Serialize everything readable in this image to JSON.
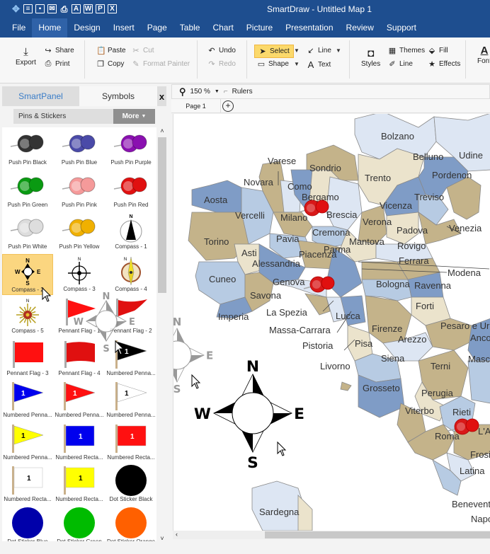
{
  "titlebar": {
    "title": "SmartDraw - Untitled Map 1",
    "quick_access": [
      "app-logo",
      "new-document",
      "save",
      "email",
      "print",
      "export-pdf",
      "export-word",
      "export-powerpoint",
      "export-excel"
    ]
  },
  "menu": {
    "items": [
      "File",
      "Home",
      "Design",
      "Insert",
      "Page",
      "Table",
      "Chart",
      "Picture",
      "Presentation",
      "Review",
      "Support"
    ],
    "active": "Home"
  },
  "ribbon": {
    "export": "Export",
    "share": "Share",
    "print": "Print",
    "paste": "Paste",
    "cut": "Cut",
    "copy": "Copy",
    "format_painter": "Format Painter",
    "undo": "Undo",
    "redo": "Redo",
    "select": "Select",
    "line": "Line",
    "shape": "Shape",
    "text": "Text",
    "styles": "Styles",
    "themes": "Themes",
    "line2": "Line",
    "fill": "Fill",
    "effects": "Effects",
    "font": "Font"
  },
  "leftpanel": {
    "tab_smartpanel": "SmartPanel",
    "tab_symbols": "Symbols",
    "close": "x",
    "library": "Pins & Stickers",
    "more": "More",
    "symbols": [
      {
        "label": "Push Pin Black",
        "kind": "pin",
        "color": "#333333"
      },
      {
        "label": "Push Pin Blue",
        "kind": "pin",
        "color": "#4a4aa8"
      },
      {
        "label": "Push Pin Purple",
        "kind": "pin",
        "color": "#8a10b0"
      },
      {
        "label": "Push Pin Green",
        "kind": "pin",
        "color": "#0a9a12"
      },
      {
        "label": "Push Pin Pink",
        "kind": "pin",
        "color": "#f59a9a"
      },
      {
        "label": "Push Pin Red",
        "kind": "pin",
        "color": "#e01010"
      },
      {
        "label": "Push Pin White",
        "kind": "pin",
        "color": "#dddddd"
      },
      {
        "label": "Push Pin Yellow",
        "kind": "pin",
        "color": "#f0b000"
      },
      {
        "label": "Compass - 1",
        "kind": "compass1"
      },
      {
        "label": "Compass - 2",
        "kind": "compass2",
        "selected": true
      },
      {
        "label": "Compass - 3",
        "kind": "compass3"
      },
      {
        "label": "Compass - 4",
        "kind": "compass4"
      },
      {
        "label": "Compass - 5",
        "kind": "compass5"
      },
      {
        "label": "Pennant Flag - 1",
        "kind": "pennant",
        "color": "#ff1010"
      },
      {
        "label": "Pennant Flag - 2",
        "kind": "wavy",
        "color": "#e01010"
      },
      {
        "label": "Pennant Flag - 3",
        "kind": "rectflag",
        "color": "#ff1010"
      },
      {
        "label": "Pennant Flag - 4",
        "kind": "wavyrect",
        "color": "#e01010"
      },
      {
        "label": "Numbered Penna...",
        "kind": "numpennant",
        "color": "#000000",
        "text_color": "#ffffff",
        "number": "1"
      },
      {
        "label": "Numbered Penna...",
        "kind": "numpennant",
        "color": "#0000ee",
        "text_color": "#ffffff",
        "number": "1"
      },
      {
        "label": "Numbered Penna...",
        "kind": "numpennant",
        "color": "#ff1010",
        "text_color": "#ffffff",
        "number": "1"
      },
      {
        "label": "Numbered Penna...",
        "kind": "numpennant",
        "color": "#ffffff",
        "text_color": "#000000",
        "number": "1"
      },
      {
        "label": "Numbered Penna...",
        "kind": "numpennant",
        "color": "#ffff00",
        "text_color": "#000000",
        "number": "1"
      },
      {
        "label": "Numbered Recta...",
        "kind": "numrect",
        "color": "#0000ee",
        "text_color": "#ffffff",
        "number": "1"
      },
      {
        "label": "Numbered Recta...",
        "kind": "numrect",
        "color": "#ff1010",
        "text_color": "#ffffff",
        "number": "1"
      },
      {
        "label": "Numbered Recta...",
        "kind": "numrect",
        "color": "#ffffff",
        "text_color": "#000000",
        "number": "1"
      },
      {
        "label": "Numbered Recta...",
        "kind": "numrect",
        "color": "#ffff00",
        "text_color": "#000000",
        "number": "1"
      },
      {
        "label": "Dot Sticker Black",
        "kind": "dot",
        "color": "#000000"
      },
      {
        "label": "Dot Sticker Blue",
        "kind": "dot",
        "color": "#0000aa"
      },
      {
        "label": "Dot Sticker Green",
        "kind": "dot",
        "color": "#00bb00"
      },
      {
        "label": "Dot Sticker Orange",
        "kind": "dot",
        "color": "#ff6000"
      }
    ]
  },
  "canvas": {
    "zoom": "150 %",
    "rulers": "Rulers",
    "page_tab": "Page 1",
    "compass_letters": {
      "n": "N",
      "e": "E",
      "s": "S",
      "w": "W"
    },
    "map_labels": [
      "Bolzano",
      "Udine",
      "Belluno",
      "Varese",
      "Sondrio",
      "Trento",
      "Pordenon",
      "Novara",
      "Como",
      "Bergamo",
      "Treviso",
      "Aosta",
      "Vercelli",
      "Milano",
      "Brescia",
      "Vicenza",
      "Cremona",
      "Verona",
      "Padova",
      "Venezia",
      "Torino",
      "Pavia",
      "Mantova",
      "Rovigo",
      "Asti",
      "Piacenza",
      "Ferrara",
      "Alessandria",
      "Parma",
      "Modena",
      "Cuneo",
      "Genova",
      "Bologna",
      "Ravenna",
      "Savona",
      "Imperia",
      "La Spezia",
      "Lucca",
      "Forti",
      "Massa-Carrara",
      "Firenze",
      "Pesaro e Ur",
      "Pistoria",
      "Pisa",
      "Arezzo",
      "Anco",
      "Livorno",
      "Siena",
      "Terni",
      "Masc",
      "Grosseto",
      "Perugia",
      "Viterbo",
      "Rieti",
      "Roma",
      "L'Ac",
      "Frosi",
      "Latina",
      "Sardegna",
      "Benevent",
      "Napo"
    ],
    "region_colors": {
      "blue_dark": "#7f9cc6",
      "blue_mid": "#b7cbe3",
      "blue_light": "#dde6f3",
      "tan_dark": "#c4b38a",
      "tan_light": "#ebe3cc"
    }
  }
}
